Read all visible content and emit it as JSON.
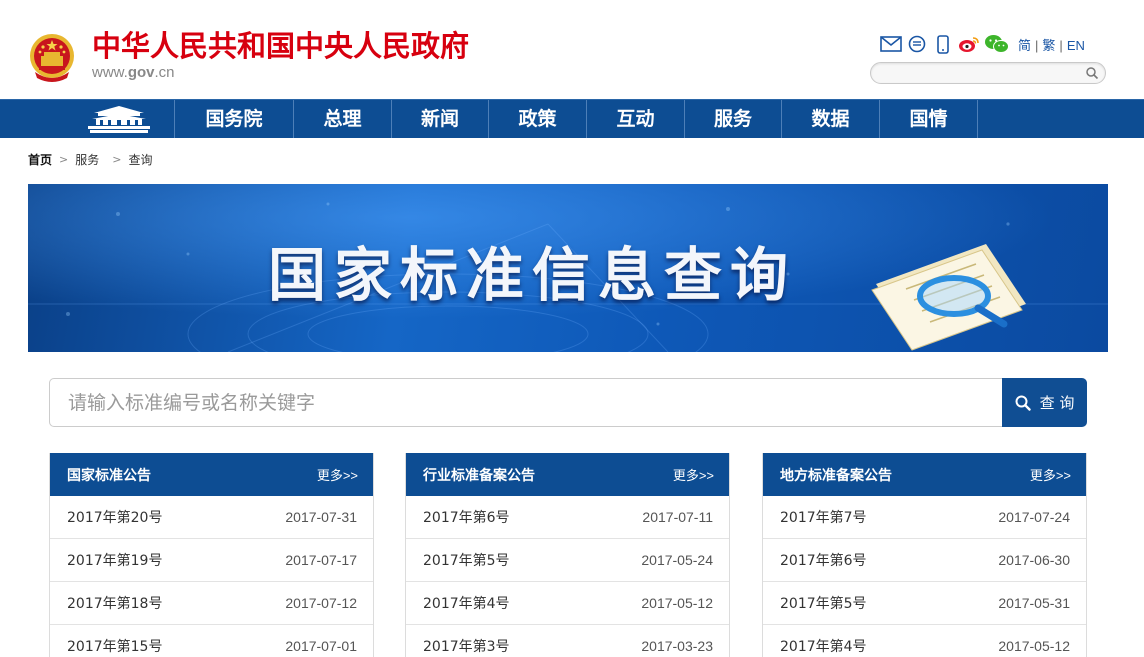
{
  "header": {
    "site_title": "中华人民共和国中央人民政府",
    "site_url_prefix": "www.",
    "site_url_bold": "gov",
    "site_url_suffix": ".cn",
    "lang_simplified": "简",
    "lang_traditional": "繁",
    "lang_english": "EN",
    "lang_separator": "|"
  },
  "nav": {
    "items": [
      "国务院",
      "总理",
      "新闻",
      "政策",
      "互动",
      "服务",
      "数据",
      "国情"
    ]
  },
  "breadcrumb": {
    "home": "首页",
    "service": "服务",
    "current": "查询",
    "arrow": ">"
  },
  "banner": {
    "title": "国家标准信息查询"
  },
  "search": {
    "placeholder": "请输入标准编号或名称关键字",
    "button_label": "查 询"
  },
  "panels": [
    {
      "title": "国家标准公告",
      "more": "更多>>",
      "rows": [
        {
          "name": "2017年第20号",
          "date": "2017-07-31"
        },
        {
          "name": "2017年第19号",
          "date": "2017-07-17"
        },
        {
          "name": "2017年第18号",
          "date": "2017-07-12"
        },
        {
          "name": "2017年第15号",
          "date": "2017-07-01"
        }
      ]
    },
    {
      "title": "行业标准备案公告",
      "more": "更多>>",
      "rows": [
        {
          "name": "2017年第6号",
          "date": "2017-07-11"
        },
        {
          "name": "2017年第5号",
          "date": "2017-05-24"
        },
        {
          "name": "2017年第4号",
          "date": "2017-05-12"
        },
        {
          "name": "2017年第3号",
          "date": "2017-03-23"
        }
      ]
    },
    {
      "title": "地方标准备案公告",
      "more": "更多>>",
      "rows": [
        {
          "name": "2017年第7号",
          "date": "2017-07-24"
        },
        {
          "name": "2017年第6号",
          "date": "2017-06-30"
        },
        {
          "name": "2017年第5号",
          "date": "2017-05-31"
        },
        {
          "name": "2017年第4号",
          "date": "2017-05-12"
        }
      ]
    }
  ],
  "colors": {
    "brand_red": "#d7000f",
    "nav_blue": "#0d4d93",
    "link_blue": "#1a56a5"
  },
  "icons": [
    "national-emblem-icon",
    "mail-icon",
    "message-icon",
    "mobile-icon",
    "weibo-icon",
    "wechat-icon",
    "search-icon",
    "tiananmen-icon"
  ]
}
